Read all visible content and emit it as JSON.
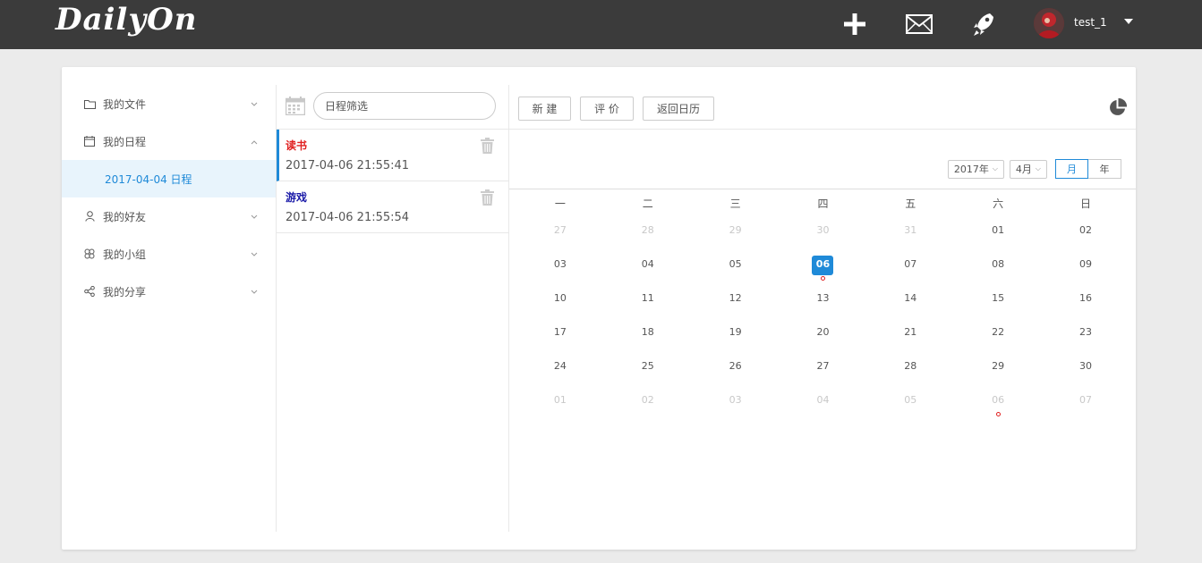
{
  "header": {
    "logo": "DailyOn",
    "username": "test_1",
    "icons": [
      "plus-icon",
      "mail-icon",
      "rocket-icon",
      "caret-down-icon"
    ]
  },
  "sidebar": {
    "items": [
      {
        "label": "我的文件",
        "icon": "folder-icon",
        "expanded": false
      },
      {
        "label": "我的日程",
        "icon": "calendar-icon",
        "expanded": true
      },
      {
        "label": "我的好友",
        "icon": "user-icon",
        "expanded": false
      },
      {
        "label": "我的小组",
        "icon": "group-icon",
        "expanded": false
      },
      {
        "label": "我的分享",
        "icon": "share-icon",
        "expanded": false
      }
    ],
    "sub_item": "2017-04-04 日程"
  },
  "schedule_list": {
    "filter_placeholder": "日程筛选",
    "items": [
      {
        "title": "读书",
        "time": "2017-04-06 21:55:41",
        "title_color": "#e02020"
      },
      {
        "title": "游戏",
        "time": "2017-04-06 21:55:54",
        "title_color": "#1a1aa8"
      }
    ]
  },
  "toolbar": {
    "new_label": "新 建",
    "review_label": "评 价",
    "back_label": "返回日历"
  },
  "calendar": {
    "year_select": "2017年",
    "month_select": "4月",
    "view_month": "月",
    "view_year": "年",
    "weekdays": [
      "一",
      "二",
      "三",
      "四",
      "五",
      "六",
      "日"
    ],
    "weeks": [
      [
        {
          "d": "27",
          "m": "other"
        },
        {
          "d": "28",
          "m": "other"
        },
        {
          "d": "29",
          "m": "other"
        },
        {
          "d": "30",
          "m": "other"
        },
        {
          "d": "31",
          "m": "other"
        },
        {
          "d": "01",
          "m": "cur"
        },
        {
          "d": "02",
          "m": "cur"
        }
      ],
      [
        {
          "d": "03",
          "m": "cur"
        },
        {
          "d": "04",
          "m": "cur"
        },
        {
          "d": "05",
          "m": "cur"
        },
        {
          "d": "06",
          "m": "today",
          "dot": true
        },
        {
          "d": "07",
          "m": "cur"
        },
        {
          "d": "08",
          "m": "cur"
        },
        {
          "d": "09",
          "m": "cur"
        }
      ],
      [
        {
          "d": "10",
          "m": "cur"
        },
        {
          "d": "11",
          "m": "cur"
        },
        {
          "d": "12",
          "m": "cur"
        },
        {
          "d": "13",
          "m": "cur"
        },
        {
          "d": "14",
          "m": "cur"
        },
        {
          "d": "15",
          "m": "cur"
        },
        {
          "d": "16",
          "m": "cur"
        }
      ],
      [
        {
          "d": "17",
          "m": "cur"
        },
        {
          "d": "18",
          "m": "cur"
        },
        {
          "d": "19",
          "m": "cur"
        },
        {
          "d": "20",
          "m": "cur"
        },
        {
          "d": "21",
          "m": "cur"
        },
        {
          "d": "22",
          "m": "cur"
        },
        {
          "d": "23",
          "m": "cur"
        }
      ],
      [
        {
          "d": "24",
          "m": "cur"
        },
        {
          "d": "25",
          "m": "cur"
        },
        {
          "d": "26",
          "m": "cur"
        },
        {
          "d": "27",
          "m": "cur"
        },
        {
          "d": "28",
          "m": "cur"
        },
        {
          "d": "29",
          "m": "cur"
        },
        {
          "d": "30",
          "m": "cur"
        }
      ],
      [
        {
          "d": "01",
          "m": "other"
        },
        {
          "d": "02",
          "m": "other"
        },
        {
          "d": "03",
          "m": "other"
        },
        {
          "d": "04",
          "m": "other"
        },
        {
          "d": "05",
          "m": "other"
        },
        {
          "d": "06",
          "m": "other",
          "dot": true
        },
        {
          "d": "07",
          "m": "other"
        }
      ]
    ]
  },
  "colors": {
    "topbar": "#3b3b3b",
    "accent": "#1f8ad8",
    "event_dot": "#e02020"
  }
}
